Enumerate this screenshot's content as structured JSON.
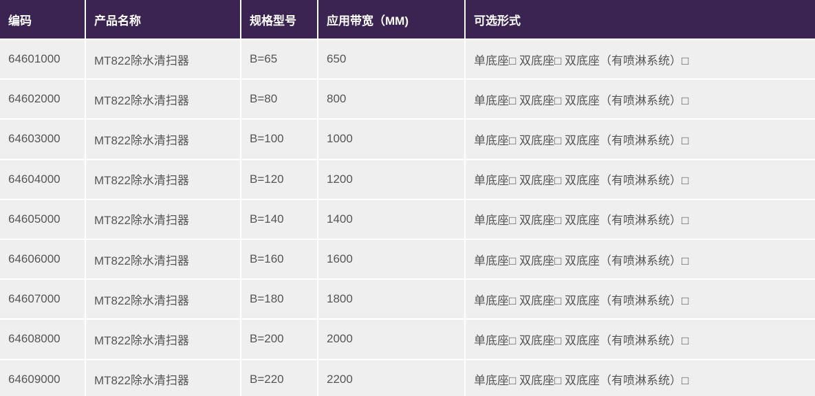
{
  "table": {
    "headers": [
      "编码",
      "产品名称",
      "规格型号",
      "应用带宽（MM)",
      "可选形式"
    ],
    "rows": [
      [
        "64601000",
        "MT822除水清扫器",
        "B=65",
        "650",
        "单底座□ 双底座□ 双底座（有喷淋系统）□"
      ],
      [
        "64602000",
        "MT822除水清扫器",
        "B=80",
        "800",
        "单底座□ 双底座□ 双底座（有喷淋系统）□"
      ],
      [
        "64603000",
        "MT822除水清扫器",
        "B=100",
        "1000",
        "单底座□ 双底座□ 双底座（有喷淋系统）□"
      ],
      [
        "64604000",
        "MT822除水清扫器",
        "B=120",
        "1200",
        "单底座□ 双底座□ 双底座（有喷淋系统）□"
      ],
      [
        "64605000",
        "MT822除水清扫器",
        "B=140",
        "1400",
        "单底座□ 双底座□ 双底座（有喷淋系统）□"
      ],
      [
        "64606000",
        "MT822除水清扫器",
        "B=160",
        "1600",
        "单底座□ 双底座□ 双底座（有喷淋系统）□"
      ],
      [
        "64607000",
        "MT822除水清扫器",
        "B=180",
        "1800",
        "单底座□ 双底座□ 双底座（有喷淋系统）□"
      ],
      [
        "64608000",
        "MT822除水清扫器",
        "B=200",
        "2000",
        "单底座□ 双底座□ 双底座（有喷淋系统）□"
      ],
      [
        "64609000",
        "MT822除水清扫器",
        "B=220",
        "2200",
        "单底座□ 双底座□ 双底座（有喷淋系统）□"
      ]
    ]
  },
  "colors": {
    "header_bg": "#3c2452",
    "header_text": "#ffffff",
    "cell_bg": "#efefef",
    "cell_text": "#555555"
  }
}
